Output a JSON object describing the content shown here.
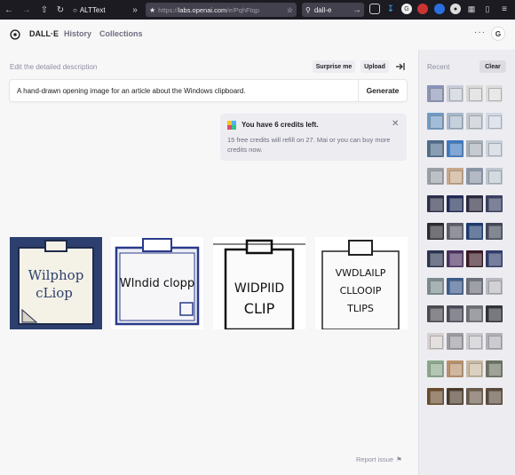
{
  "browser": {
    "url_prefix": "https://",
    "url_domain": "labs.openai.com",
    "url_path": "/e/PqhFtqp",
    "search_text": "dall-e",
    "bookmark_label": "ALTText"
  },
  "header": {
    "app_name": "DALL·E",
    "nav": [
      "History",
      "Collections"
    ],
    "more": "···",
    "avatar_letter": "G"
  },
  "editor": {
    "caption": "Edit the detailed description",
    "surprise_label": "Surprise me",
    "upload_label": "Upload",
    "prompt": "A hand-drawn opening image for an article about the Windows clipboard.",
    "generate_label": "Generate"
  },
  "credits": {
    "title": "You have 6 credits left.",
    "body": "15 free credits will refill on 27. Mai or you can buy more credits now."
  },
  "results": [
    {
      "line1": "Wilphop",
      "line2": "cLiop",
      "line3": ""
    },
    {
      "line1": "Wlndid clopp",
      "line2": "",
      "line3": ""
    },
    {
      "line1": "WIDPIID",
      "line2": "CLIP",
      "line3": ""
    },
    {
      "line1": "VWDLAILP",
      "line2": "CLLOOIP",
      "line3": "TLIPS"
    }
  ],
  "report_label": "Report issue",
  "sidebar": {
    "title": "Recent",
    "clear_label": "Clear",
    "thumb_colors": [
      "#8a93b8",
      "#c9cdd8",
      "#d8d8d8",
      "#dcdcdc",
      "#6f9ac7",
      "#a8b8cc",
      "#c2c8d0",
      "#d0d8e4",
      "#4b6b8c",
      "#3e78c0",
      "#a7b0b8",
      "#c9d2dc",
      "#9aa0a6",
      "#c8a888",
      "#8a96a6",
      "#bcc6cf",
      "#2b2f4a",
      "#1f2a55",
      "#2a2840",
      "#3a3f62",
      "#2a2a30",
      "#5a5a68",
      "#1d3b6e",
      "#404858",
      "#2a3350",
      "#4a3060",
      "#3a1a25",
      "#2f3b6a",
      "#7a8a8f",
      "#3a5a8a",
      "#6a6e78",
      "#b8b8c0",
      "#4a4a50",
      "#4a4a58",
      "#6a6e74",
      "#30323a",
      "#d8d0d0",
      "#9a9aa0",
      "#c8c8cc",
      "#b0b0b8",
      "#8aa88a",
      "#b8906a",
      "#c8b8a0",
      "#6a7060",
      "#6a4a2a",
      "#4a3a2a",
      "#6a5a4a",
      "#5a4a3a"
    ]
  }
}
